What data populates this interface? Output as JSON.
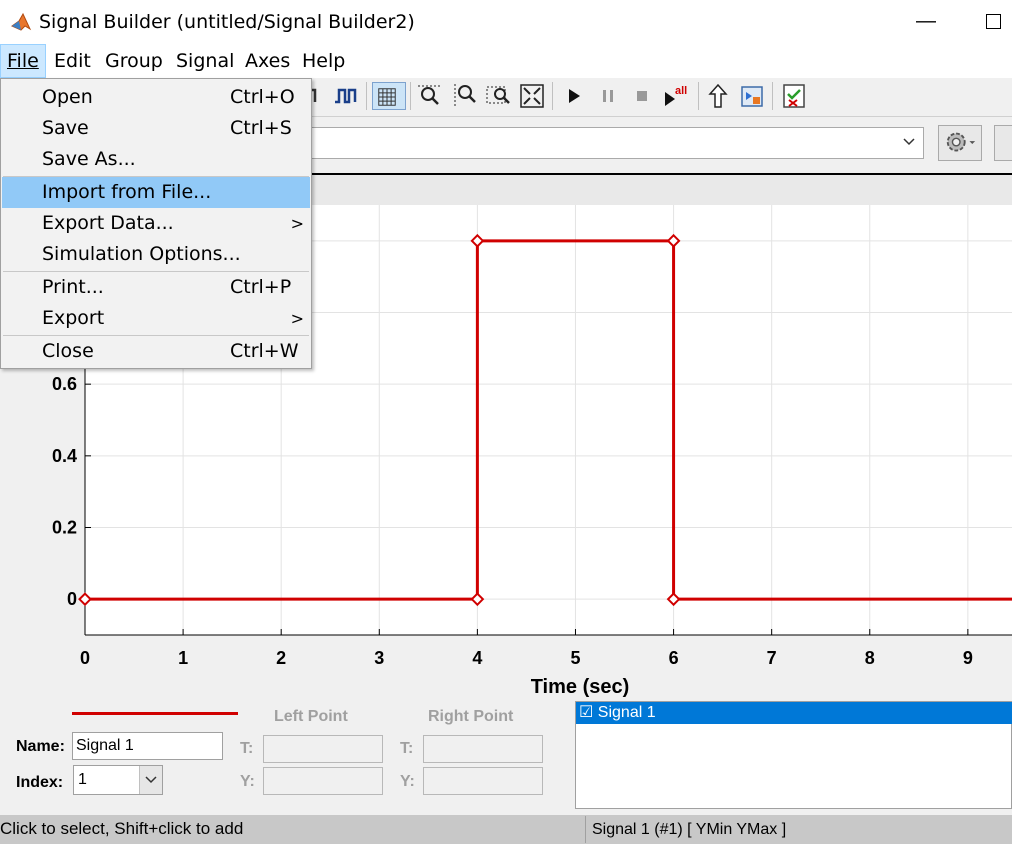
{
  "window": {
    "title": "Signal Builder (untitled/Signal Builder2)"
  },
  "menubar": {
    "items": [
      "File",
      "Edit",
      "Group",
      "Signal",
      "Axes",
      "Help"
    ]
  },
  "file_menu": {
    "items": [
      {
        "label": "Open",
        "shortcut": "Ctrl+O"
      },
      {
        "label": "Save",
        "shortcut": "Ctrl+S"
      },
      {
        "label": "Save As...",
        "shortcut": ""
      },
      {
        "label": "Import from File...",
        "shortcut": ""
      },
      {
        "label": "Export Data...",
        "shortcut": "",
        "submenu": ">"
      },
      {
        "label": "Simulation Options...",
        "shortcut": ""
      },
      {
        "label": "Print...",
        "shortcut": "Ctrl+P"
      },
      {
        "label": "Export",
        "shortcut": "",
        "submenu": ">"
      },
      {
        "label": "Close",
        "shortcut": "Ctrl+W"
      }
    ]
  },
  "toolbar": {
    "icons": [
      "step-icon",
      "pulse-icon",
      "grid-icon",
      "zoom-t-icon",
      "zoom-y-icon",
      "zoom-box-icon",
      "fit-view-icon",
      "play-icon",
      "pause-icon",
      "stop-icon",
      "play-all-icon",
      "up-arrow-icon",
      "open-model-icon",
      "requirements-icon"
    ]
  },
  "chart_data": {
    "type": "line",
    "x": [
      0,
      4,
      4,
      6,
      6,
      10
    ],
    "y": [
      0,
      0,
      1,
      1,
      0,
      0
    ],
    "points": [
      [
        0,
        0
      ],
      [
        4,
        0
      ],
      [
        4,
        1
      ],
      [
        6,
        1
      ],
      [
        6,
        0
      ]
    ],
    "xlabel": "Time (sec)",
    "xticks": [
      "0",
      "1",
      "2",
      "3",
      "4",
      "5",
      "6",
      "7",
      "8",
      "9"
    ],
    "yticks": [
      "0",
      "0.2",
      "0.4",
      "0.6"
    ],
    "xlim": [
      0,
      9.45
    ],
    "ylim": [
      -0.1,
      1.1
    ],
    "grid": true,
    "color": "#d00000"
  },
  "panel": {
    "left_point_label": "Left Point",
    "right_point_label": "Right Point",
    "name_label": "Name:",
    "name_value": "Signal 1",
    "index_label": "Index:",
    "index_value": "1",
    "t_label": "T:",
    "y_label": "Y:"
  },
  "signal_list": {
    "items": [
      "☑ Signal 1"
    ]
  },
  "status": {
    "left": "Click to select, Shift+click to add",
    "right": "Signal 1 (#1)  [ YMin YMax ]"
  }
}
